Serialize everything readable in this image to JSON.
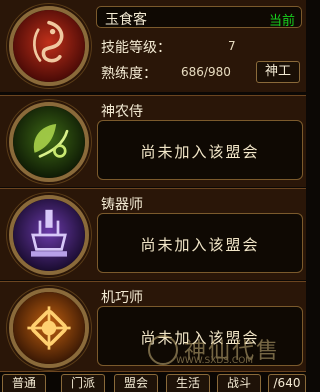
{
  "top_profession": {
    "name": "玉食客",
    "status": "当前",
    "skill_level_label": "技能等级：",
    "skill_level_value": "7",
    "proficiency_label": "熟练度：",
    "proficiency_value": "686/980",
    "rank_button": "神工"
  },
  "professions": [
    {
      "name": "神农侍",
      "status_text": "尚未加入该盟会"
    },
    {
      "name": "铸器师",
      "status_text": "尚未加入该盟会"
    },
    {
      "name": "机巧师",
      "status_text": "尚未加入该盟会"
    }
  ],
  "tabs": [
    "普通",
    "门派",
    "盟会",
    "生活",
    "战斗",
    "/640"
  ],
  "watermark": {
    "text": "神仙代售",
    "url": "WWW.SXDS.COM"
  },
  "colors": {
    "current_green": "#18d21e",
    "emblem_red": "#8b1a10",
    "emblem_green": "#2f5a12",
    "emblem_purple": "#4a2a78",
    "emblem_orange": "#9a4a08"
  },
  "icons": [
    "dragon-emblem-icon",
    "leaf-emblem-icon",
    "forge-emblem-icon",
    "gear-emblem-icon"
  ]
}
